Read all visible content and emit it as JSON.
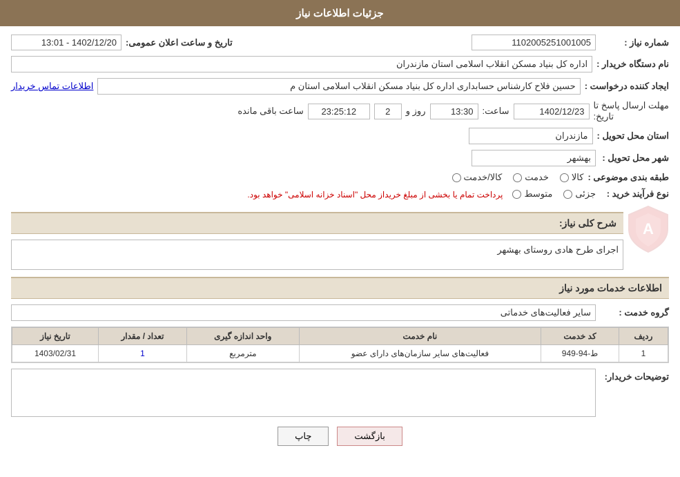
{
  "header": {
    "title": "جزئیات اطلاعات نیاز"
  },
  "fields": {
    "need_number_label": "شماره نیاز :",
    "need_number_value": "1102005251001005",
    "announcement_date_label": "تاریخ و ساعت اعلان عمومی:",
    "announcement_date_value": "1402/12/20 - 13:01",
    "buyer_org_label": "نام دستگاه خریدار :",
    "buyer_org_value": "اداره کل بنیاد مسکن انقلاب اسلامی استان مازندران",
    "creator_label": "ایجاد کننده درخواست :",
    "creator_value": "حسین فلاح کارشناس حسابداری اداره کل بنیاد مسکن انقلاب اسلامی استان م",
    "creator_link": "اطلاعات تماس خریدار",
    "deadline_label": "مهلت ارسال پاسخ تا",
    "deadline_label2": "تاریخ:",
    "deadline_date": "1402/12/23",
    "deadline_time_label": "ساعت:",
    "deadline_time": "13:30",
    "deadline_days_label": "روز و",
    "deadline_days": "2",
    "deadline_remaining_label": "ساعت باقی مانده",
    "deadline_time_remaining": "23:25:12",
    "province_label": "استان محل تحویل :",
    "province_value": "مازندران",
    "city_label": "شهر محل تحویل :",
    "city_value": "بهشهر",
    "category_label": "طبقه بندی موضوعی :",
    "category_options": [
      {
        "label": "کالا",
        "value": "kala",
        "checked": false
      },
      {
        "label": "خدمت",
        "value": "khedmat",
        "checked": false
      },
      {
        "label": "کالا/خدمت",
        "value": "kala_khedmat",
        "checked": false
      }
    ],
    "purchase_type_label": "نوع فرآیند خرید :",
    "purchase_type_options": [
      {
        "label": "جزئی",
        "value": "jozei",
        "checked": false
      },
      {
        "label": "متوسط",
        "value": "mottavaset",
        "checked": false
      }
    ],
    "purchase_type_note": "پرداخت تمام یا بخشی از مبلغ خریداز محل \"اسناد خزانه اسلامی\" خواهد بود.",
    "need_description_label": "شرح کلی نیاز:",
    "need_description_value": "اجرای طرح هادی روستای بهشهر",
    "services_section_title": "اطلاعات خدمات مورد نیاز",
    "service_group_label": "گروه خدمت :",
    "service_group_value": "سایر فعالیت‌های خدماتی",
    "table": {
      "headers": [
        "ردیف",
        "کد خدمت",
        "نام خدمت",
        "واحد اندازه گیری",
        "تعداد / مقدار",
        "تاریخ نیاز"
      ],
      "rows": [
        {
          "row_num": "1",
          "service_code": "ط-94-949",
          "service_name": "فعالیت‌های سایر سازمان‌های دارای عضو",
          "unit": "مترمربع",
          "quantity": "1",
          "date": "1403/02/31"
        }
      ]
    },
    "buyer_notes_label": "توضیحات خریدار:",
    "buyer_notes_value": ""
  },
  "buttons": {
    "print_label": "چاپ",
    "back_label": "بازگشت"
  }
}
